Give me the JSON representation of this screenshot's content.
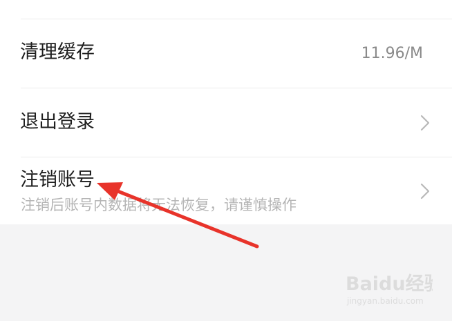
{
  "settings": {
    "clear_cache": {
      "label": "清理缓存",
      "value": "11.96/M"
    },
    "logout": {
      "label": "退出登录"
    },
    "deactivate": {
      "label": "注销账号",
      "subtitle": "注销后账号内数据将无法恢复，请谨慎操作"
    }
  },
  "icons": {
    "row_arrow": "chevron-right-icon"
  },
  "colors": {
    "annotation_arrow": "#e8332a",
    "background": "#f4f4f5"
  },
  "watermark": {
    "brand": "Baidu经验",
    "url": "jingyan.baidu.com"
  }
}
